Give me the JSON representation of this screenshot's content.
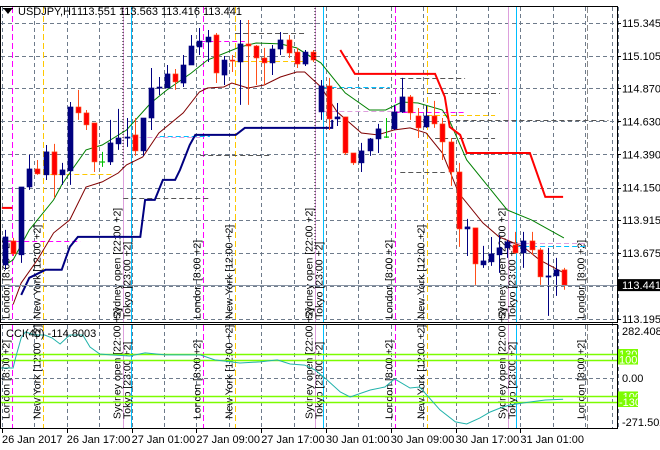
{
  "header": {
    "symbol": "USDJPY,H1",
    "ohlc": "113.551 113.563 113.416 113.441",
    "menu_icon": "triangle-down-icon"
  },
  "price_axis": {
    "labels": [
      "115.345",
      "115.105",
      "114.870",
      "114.630",
      "114.390",
      "114.150",
      "113.915",
      "113.675",
      "113.195"
    ],
    "current_price": "113.441",
    "range": [
      113.195,
      115.345
    ]
  },
  "indicator": {
    "label": "CCI(40) -114.8003",
    "max_label": "282.4088",
    "zero_label": "0.00",
    "min_label": "-271.5025",
    "range": [
      -271.5025,
      282.4088
    ],
    "levels": [
      {
        "value": 130,
        "label": "130"
      },
      {
        "value": 100,
        "label": "100"
      },
      {
        "value": -100,
        "label": "-100"
      },
      {
        "value": -130,
        "label": "-130"
      }
    ],
    "level_color": "#7cfc00",
    "line_color": "#20b2aa",
    "points": [
      [
        -0.5,
        54
      ],
      [
        1,
        54
      ],
      [
        1.3,
        108
      ],
      [
        2,
        217
      ],
      [
        2.5,
        249
      ],
      [
        3.7,
        233
      ],
      [
        4.9,
        233
      ],
      [
        5.8,
        217
      ],
      [
        6.8,
        184
      ],
      [
        8,
        233
      ],
      [
        9.6,
        233
      ],
      [
        10.5,
        168
      ],
      [
        11.7,
        130
      ],
      [
        13,
        125
      ],
      [
        15.4,
        119
      ],
      [
        17.3,
        136
      ],
      [
        19.8,
        125
      ],
      [
        21.6,
        125
      ],
      [
        24.1,
        125
      ],
      [
        25.9,
        98
      ],
      [
        29,
        81
      ],
      [
        31.5,
        87
      ],
      [
        33.6,
        98
      ],
      [
        35.2,
        76
      ],
      [
        37,
        70
      ],
      [
        38.3,
        43
      ],
      [
        39.5,
        0
      ],
      [
        41.4,
        -76
      ],
      [
        42.6,
        -103
      ],
      [
        45.1,
        -65
      ],
      [
        46.9,
        -49
      ],
      [
        48.1,
        -5
      ],
      [
        50,
        -54
      ],
      [
        51.2,
        -49
      ],
      [
        53.7,
        -173
      ],
      [
        55.6,
        -238
      ],
      [
        57,
        -249
      ],
      [
        58.6,
        -217
      ],
      [
        59.9,
        -184
      ],
      [
        61.1,
        -163
      ],
      [
        62.3,
        -146
      ],
      [
        64.8,
        -130
      ],
      [
        66.7,
        -119
      ],
      [
        68.9,
        -114.8
      ]
    ]
  },
  "time_axis": {
    "labels": [
      {
        "bar": 0,
        "text": "26 Jan 2017"
      },
      {
        "bar": 8,
        "text": "26 Jan 17:00"
      },
      {
        "bar": 16,
        "text": "27 Jan 01:00"
      },
      {
        "bar": 24,
        "text": "27 Jan 09:00"
      },
      {
        "bar": 32,
        "text": "27 Jan 17:00"
      },
      {
        "bar": 40,
        "text": "30 Jan 01:00"
      },
      {
        "bar": 48,
        "text": "30 Jan 09:00"
      },
      {
        "bar": 56,
        "text": "30 Jan 17:00"
      },
      {
        "bar": 64,
        "text": "31 Jan 01:00"
      }
    ]
  },
  "colors": {
    "bull": "#000080",
    "bear": "#ff0000",
    "bear_wick": "#ff4f1a",
    "doji": "#00c000",
    "grid": "#6e7b8b",
    "fast_ma": "#008000",
    "slow_ma": "#800000",
    "support": "#000080",
    "stop": "#ff0000"
  },
  "sessions": [
    {
      "name": "London",
      "label": "London [8:00 +2]",
      "color": "#ff00ff",
      "dashed": true,
      "bars": [
        0.9,
        24.4,
        48.1
      ]
    },
    {
      "name": "New York",
      "label": "New York [12:00 +2]",
      "color": "#ffc800",
      "dashed": true,
      "bars": [
        4.7,
        28.4,
        52.1
      ]
    },
    {
      "name": "Sydney",
      "label": "Sydney open [22:00 +2]",
      "color": "#dda0dd",
      "dashed": false,
      "bars": [
        14.6,
        38.3,
        62.1
      ]
    },
    {
      "name": "Tokyo",
      "label": "Tokyo [23:00 +2]",
      "color": "#00bfff",
      "dashed": false,
      "bars": [
        15.6,
        39.3,
        63.1
      ]
    },
    {
      "name": "London-next",
      "label": "London [8:00 +2]",
      "color": "#8a8a8a",
      "dashed": true,
      "bars": [
        71.9
      ]
    }
  ],
  "session_levels": [
    {
      "price": 114.248,
      "from": 5.6,
      "to": 13.2,
      "color": "#ffc800"
    },
    {
      "price": 113.762,
      "from": 0.4,
      "to": 9.3,
      "color": "#ff00ff"
    },
    {
      "price": 114.517,
      "from": 15.6,
      "to": 24.1,
      "color": "#dda0dd"
    },
    {
      "price": 114.524,
      "from": 19.1,
      "to": 25.3,
      "color": "#00bfff"
    },
    {
      "price": 115.214,
      "from": 24.1,
      "to": 29.6,
      "color": "#ff00ff"
    },
    {
      "price": 115.069,
      "from": 28.4,
      "to": 37,
      "color": "#ffc800"
    },
    {
      "price": 114.88,
      "from": 39.3,
      "to": 47.5,
      "color": "#00bfff"
    },
    {
      "price": 114.706,
      "from": 39.3,
      "to": 50,
      "color": "#dda0dd"
    },
    {
      "price": 114.698,
      "from": 48.1,
      "to": 56.8,
      "color": "#ff00ff"
    },
    {
      "price": 114.677,
      "from": 52.1,
      "to": 60.5,
      "color": "#ffc800"
    },
    {
      "price": 113.747,
      "from": 62.1,
      "to": 71.6,
      "color": "#dda0dd"
    },
    {
      "price": 113.725,
      "from": 63.1,
      "to": 71.6,
      "color": "#00bfff"
    },
    {
      "price": 115.272,
      "from": 28.4,
      "to": 37,
      "color": "#555555"
    },
    {
      "price": 114.386,
      "from": 24.1,
      "to": 33,
      "color": "#555555"
    },
    {
      "price": 114.074,
      "from": 14.6,
      "to": 25.3,
      "color": "#555555"
    },
    {
      "price": 114.946,
      "from": 48.8,
      "to": 56.8,
      "color": "#555555"
    },
    {
      "price": 114.837,
      "from": 52.1,
      "to": 61.1,
      "color": "#555555"
    },
    {
      "price": 114.641,
      "from": 55.6,
      "to": 74.5,
      "color": "#555555"
    },
    {
      "price": 114.51,
      "from": 53.1,
      "to": 60.5,
      "color": "#555555"
    },
    {
      "price": 114.263,
      "from": 48.8,
      "to": 54.3,
      "color": "#555555"
    }
  ],
  "chart_data": {
    "type": "candlestick",
    "title": "USDJPY,H1",
    "ylim": [
      113.195,
      115.345
    ],
    "candles": [
      [
        113.588,
        113.842,
        113.552,
        113.791
      ],
      [
        113.762,
        113.784,
        113.653,
        113.668
      ],
      [
        113.661,
        114.154,
        113.603,
        114.154
      ],
      [
        114.154,
        114.387,
        114.133,
        114.285
      ],
      [
        114.285,
        114.35,
        114.242,
        114.249
      ],
      [
        114.242,
        114.459,
        114.205,
        114.409
      ],
      [
        114.409,
        114.467,
        114.075,
        114.242
      ],
      [
        114.242,
        114.329,
        114.169,
        114.278
      ],
      [
        114.271,
        114.771,
        114.169,
        114.735
      ],
      [
        114.735,
        114.859,
        114.641,
        114.692
      ],
      [
        114.692,
        114.713,
        114.568,
        114.605
      ],
      [
        114.619,
        114.619,
        114.263,
        114.336
      ],
      [
        114.336,
        114.409,
        114.3,
        114.336
      ],
      [
        114.336,
        114.641,
        114.314,
        114.474
      ],
      [
        114.467,
        114.721,
        114.423,
        114.51
      ],
      [
        114.51,
        114.655,
        114.445,
        114.517
      ],
      [
        114.532,
        114.655,
        114.38,
        114.416
      ],
      [
        114.416,
        114.655,
        114.38,
        114.655
      ],
      [
        114.655,
        115.018,
        114.568,
        114.873
      ],
      [
        114.873,
        114.953,
        114.822,
        114.88
      ],
      [
        114.873,
        115.04,
        114.873,
        114.975
      ],
      [
        114.975,
        115.011,
        114.859,
        114.917
      ],
      [
        114.909,
        115.113,
        114.88,
        115.04
      ],
      [
        115.04,
        115.258,
        115.04,
        115.178
      ],
      [
        115.171,
        115.309,
        115.113,
        115.214
      ],
      [
        115.207,
        115.294,
        115.062,
        115.243
      ],
      [
        115.258,
        115.272,
        114.909,
        114.982
      ],
      [
        114.967,
        115.105,
        114.895,
        115.076
      ],
      [
        115.076,
        115.113,
        114.989,
        115.069
      ],
      [
        115.062,
        115.367,
        114.75,
        115.193
      ],
      [
        115.193,
        115.367,
        114.75,
        115.178
      ],
      [
        115.178,
        115.185,
        114.895,
        115.091
      ],
      [
        115.091,
        115.164,
        114.895,
        115.055
      ],
      [
        115.055,
        115.185,
        114.967,
        115.156
      ],
      [
        115.156,
        115.28,
        115.113,
        115.222
      ],
      [
        115.222,
        115.258,
        115.091,
        115.127
      ],
      [
        115.134,
        115.164,
        115.018,
        115.047
      ],
      [
        115.047,
        115.149,
        115.033,
        115.134
      ],
      [
        115.134,
        115.149,
        115.062,
        115.076
      ],
      [
        114.699,
        114.931,
        114.641,
        114.888
      ],
      [
        114.888,
        114.946,
        114.568,
        114.648
      ],
      [
        114.648,
        114.764,
        114.597,
        114.663
      ],
      [
        114.663,
        114.663,
        114.387,
        114.401
      ],
      [
        114.401,
        114.401,
        114.314,
        114.329
      ],
      [
        114.329,
        114.474,
        114.263,
        114.416
      ],
      [
        114.416,
        114.51,
        114.38,
        114.503
      ],
      [
        114.503,
        114.612,
        114.401,
        114.576
      ],
      [
        114.517,
        114.655,
        114.51,
        114.517
      ],
      [
        114.576,
        114.75,
        114.568,
        114.699
      ],
      [
        114.699,
        114.946,
        114.692,
        114.808
      ],
      [
        114.808,
        114.822,
        114.641,
        114.692
      ],
      [
        114.67,
        114.728,
        114.51,
        114.583
      ],
      [
        114.59,
        114.742,
        114.583,
        114.67
      ],
      [
        114.67,
        114.779,
        114.583,
        114.612
      ],
      [
        114.612,
        114.655,
        114.35,
        114.481
      ],
      [
        114.481,
        114.51,
        114.162,
        114.263
      ],
      [
        114.263,
        114.329,
        113.719,
        113.849
      ],
      [
        113.849,
        113.922,
        113.653,
        113.864
      ],
      [
        113.857,
        113.857,
        113.443,
        113.595
      ],
      [
        113.588,
        113.726,
        113.566,
        113.617
      ],
      [
        113.61,
        113.791,
        113.581,
        113.668
      ],
      [
        113.661,
        113.806,
        113.53,
        113.712
      ],
      [
        113.712,
        113.77,
        113.639,
        113.755
      ],
      [
        113.733,
        113.828,
        113.668,
        113.675
      ],
      [
        113.675,
        113.828,
        113.566,
        113.762
      ],
      [
        113.762,
        113.828,
        113.661,
        113.697
      ],
      [
        113.697,
        113.712,
        113.443,
        113.501
      ],
      [
        113.501,
        113.712,
        113.218,
        113.508
      ],
      [
        113.508,
        113.639,
        113.363,
        113.552
      ],
      [
        113.552,
        113.566,
        113.407,
        113.441
      ]
    ],
    "fast_ma": [
      [
        0,
        113.588
      ],
      [
        1,
        113.624
      ],
      [
        3,
        113.842
      ],
      [
        6,
        114.06
      ],
      [
        7,
        114.169
      ],
      [
        8,
        114.256
      ],
      [
        10,
        114.423
      ],
      [
        12,
        114.459
      ],
      [
        15,
        114.568
      ],
      [
        18,
        114.764
      ],
      [
        20,
        114.859
      ],
      [
        23,
        114.982
      ],
      [
        25,
        115.076
      ],
      [
        29,
        115.171
      ],
      [
        31,
        115.2
      ],
      [
        34,
        115.193
      ],
      [
        36,
        115.164
      ],
      [
        39,
        115.055
      ],
      [
        42,
        114.837
      ],
      [
        45,
        114.713
      ],
      [
        47,
        114.713
      ],
      [
        49,
        114.771
      ],
      [
        51,
        114.764
      ],
      [
        54,
        114.713
      ],
      [
        55,
        114.619
      ],
      [
        57,
        114.35
      ],
      [
        60,
        114.133
      ],
      [
        62,
        113.987
      ],
      [
        65,
        113.915
      ],
      [
        69,
        113.784
      ]
    ],
    "slow_ma": [
      [
        1,
        113.3
      ],
      [
        2,
        113.457
      ],
      [
        4,
        113.624
      ],
      [
        6,
        113.82
      ],
      [
        8,
        113.915
      ],
      [
        10,
        114.154
      ],
      [
        12,
        114.191
      ],
      [
        14,
        114.256
      ],
      [
        15,
        114.314
      ],
      [
        17,
        114.372
      ],
      [
        19,
        114.546
      ],
      [
        22,
        114.692
      ],
      [
        24,
        114.844
      ],
      [
        25,
        114.873
      ],
      [
        27,
        114.88
      ],
      [
        28,
        114.909
      ],
      [
        30,
        114.873
      ],
      [
        32,
        114.895
      ],
      [
        34,
        114.953
      ],
      [
        36,
        114.989
      ],
      [
        37,
        114.989
      ],
      [
        39,
        114.88
      ],
      [
        41,
        114.699
      ],
      [
        44,
        114.546
      ],
      [
        46,
        114.532
      ],
      [
        48,
        114.568
      ],
      [
        50,
        114.583
      ],
      [
        52,
        114.546
      ],
      [
        54,
        114.401
      ],
      [
        56,
        114.111
      ],
      [
        59,
        113.893
      ],
      [
        61,
        113.791
      ],
      [
        64,
        113.719
      ],
      [
        66,
        113.624
      ],
      [
        69,
        113.53
      ]
    ],
    "support_line": [
      [
        2,
        113.37
      ],
      [
        3,
        113.494
      ],
      [
        5,
        113.552
      ],
      [
        7,
        113.552
      ],
      [
        8,
        113.719
      ],
      [
        9,
        113.791
      ],
      [
        16.7,
        113.791
      ],
      [
        17.3,
        114.06
      ],
      [
        18.5,
        114.06
      ],
      [
        19.5,
        114.205
      ],
      [
        21,
        114.205
      ],
      [
        21.6,
        114.278
      ],
      [
        22.8,
        114.459
      ],
      [
        23.5,
        114.532
      ],
      [
        28.5,
        114.532
      ],
      [
        29.6,
        114.583
      ],
      [
        40.4,
        114.583
      ],
      [
        40.4,
        114.641
      ]
    ],
    "stop_line": [
      [
        41.4,
        115.149
      ],
      [
        43.2,
        114.975
      ],
      [
        53.1,
        114.975
      ],
      [
        54.3,
        114.808
      ],
      [
        54.9,
        114.59
      ],
      [
        56.2,
        114.532
      ],
      [
        57,
        114.401
      ],
      [
        64.8,
        114.401
      ],
      [
        66.7,
        114.082
      ],
      [
        68.9,
        114.082
      ]
    ],
    "stop_tick": [
      [
        -0.4,
        114.002
      ],
      [
        0.9,
        114.002
      ]
    ]
  }
}
